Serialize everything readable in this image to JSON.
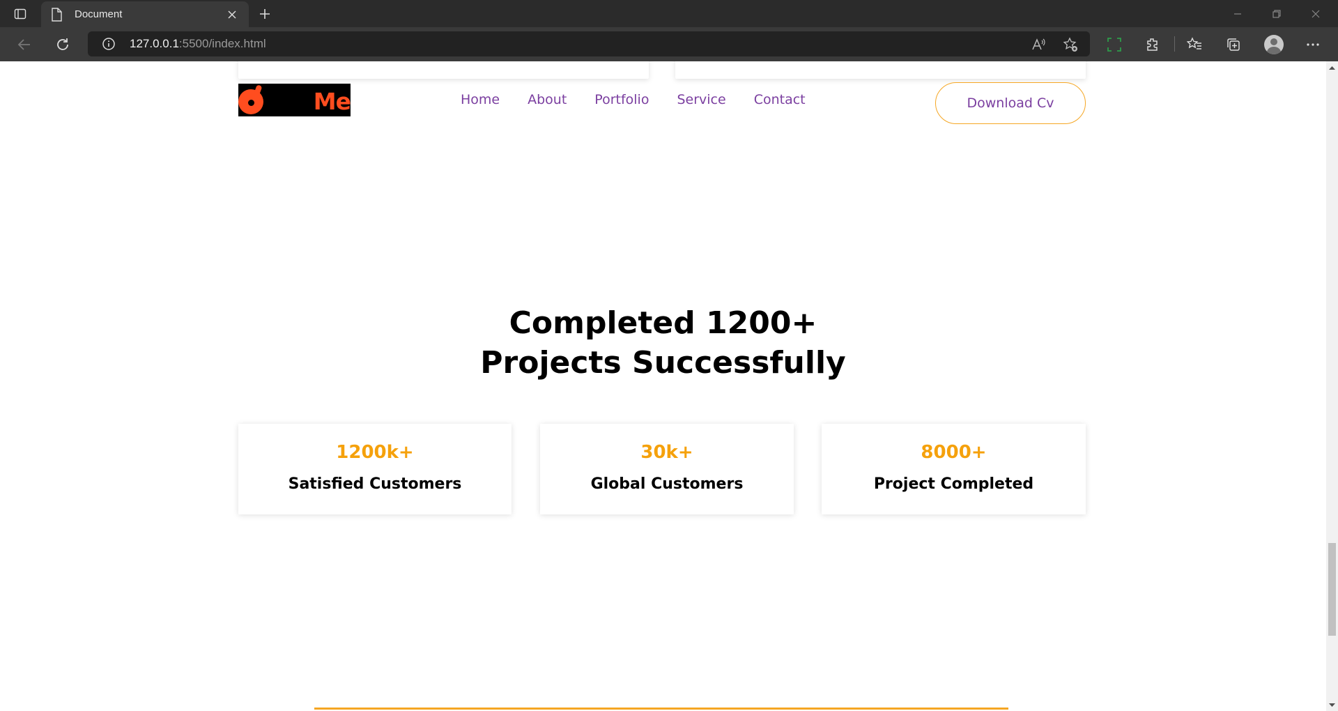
{
  "browser": {
    "tab_title": "Document",
    "url_host": "127.0.0.1",
    "url_rest": ":5500/index.html",
    "icons": [
      "tab-actions-icon",
      "document-icon",
      "close-icon",
      "new-tab-icon",
      "minimize-icon",
      "restore-icon",
      "window-close-icon",
      "back-icon",
      "refresh-icon",
      "info-icon",
      "read-aloud-icon",
      "favorite-add-icon",
      "screenshot-icon",
      "extensions-icon",
      "favorites-icon",
      "collections-icon",
      "profile-icon",
      "more-icon"
    ]
  },
  "navbar": {
    "logo_text": "Me",
    "menu": [
      {
        "label": "Home"
      },
      {
        "label": "About"
      },
      {
        "label": "Portfolio"
      },
      {
        "label": "Service"
      },
      {
        "label": "Contact"
      }
    ],
    "download_label": "Download Cv"
  },
  "headline": {
    "line1": "Completed 1200+",
    "line2": "Projects Successfully"
  },
  "stats": [
    {
      "value": "1200k+",
      "label": "Satisfied Customers"
    },
    {
      "value": "30k+",
      "label": "Global Customers"
    },
    {
      "value": "8000+",
      "label": "Project Completed"
    }
  ],
  "colors": {
    "accent_orange": "#f5a10c",
    "nav_purple": "#7b3fa0",
    "logo_red": "#ff4d1f"
  }
}
